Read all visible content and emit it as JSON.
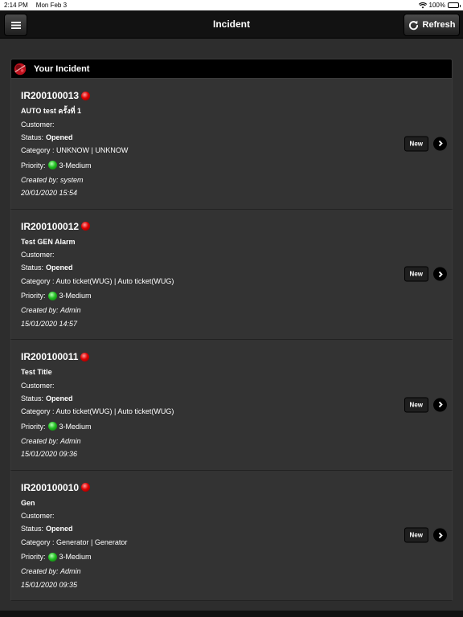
{
  "status_bar": {
    "time": "2:14 PM",
    "date": "Mon Feb 3",
    "battery": "100%"
  },
  "navbar": {
    "title": "Incident",
    "refresh_label": "Refresh"
  },
  "panel": {
    "title": "Your Incident"
  },
  "labels": {
    "customer": "Customer:",
    "status": "Status:",
    "priority": "Priority:",
    "created_by": "Created by:"
  },
  "incidents": [
    {
      "id": "IR200100013",
      "title": "AUTO test ครั้งที่ 1",
      "status": "Opened",
      "category": "Category : UNKNOW | UNKNOW",
      "priority": "3-Medium",
      "created_by": "system",
      "date": "20/01/2020 15:54",
      "state": "New"
    },
    {
      "id": "IR200100012",
      "title": "Test GEN Alarm",
      "status": "Opened",
      "category": "Category : Auto ticket(WUG) | Auto ticket(WUG)",
      "priority": "3-Medium",
      "created_by": "Admin",
      "date": "15/01/2020 14:57",
      "state": "New"
    },
    {
      "id": "IR200100011",
      "title": "Test Title",
      "status": "Opened",
      "category": "Category : Auto ticket(WUG) | Auto ticket(WUG)",
      "priority": "3-Medium",
      "created_by": "Admin",
      "date": "15/01/2020 09:36",
      "state": "New"
    },
    {
      "id": "IR200100010",
      "title": "Gen",
      "status": "Opened",
      "category": "Category : Generator | Generator",
      "priority": "3-Medium",
      "created_by": "Admin",
      "date": "15/01/2020 09:35",
      "state": "New"
    }
  ]
}
